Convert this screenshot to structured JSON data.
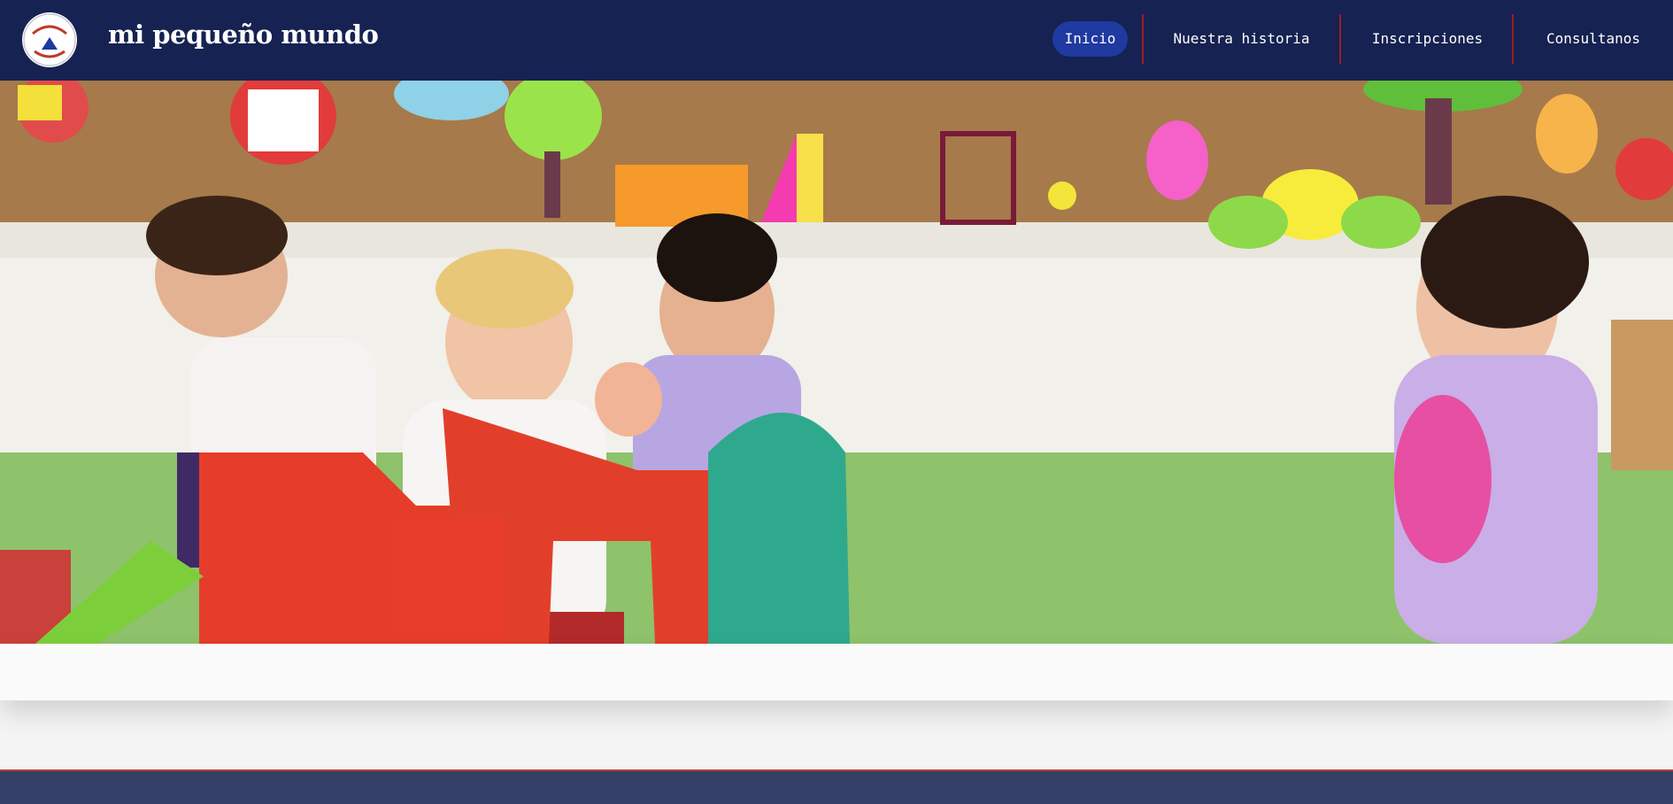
{
  "brand": {
    "name": "mi pequeño mundo",
    "logo_text_top": "MI PEQUEÑO",
    "logo_text_bottom": "MUNDO"
  },
  "nav": {
    "items": [
      {
        "label": "Inicio",
        "active": true
      },
      {
        "label": "Nuestra historia",
        "active": false
      },
      {
        "label": "Inscripciones",
        "active": false
      },
      {
        "label": "Consultanos",
        "active": false
      }
    ]
  },
  "hero": {
    "image_alt": "children-playing-classroom-photo"
  },
  "colors": {
    "navbar": "#162251",
    "active_nav": "#1f3aa0",
    "divider": "#9b1d2a",
    "footer": "#344068",
    "footer_border": "#c0392b"
  }
}
